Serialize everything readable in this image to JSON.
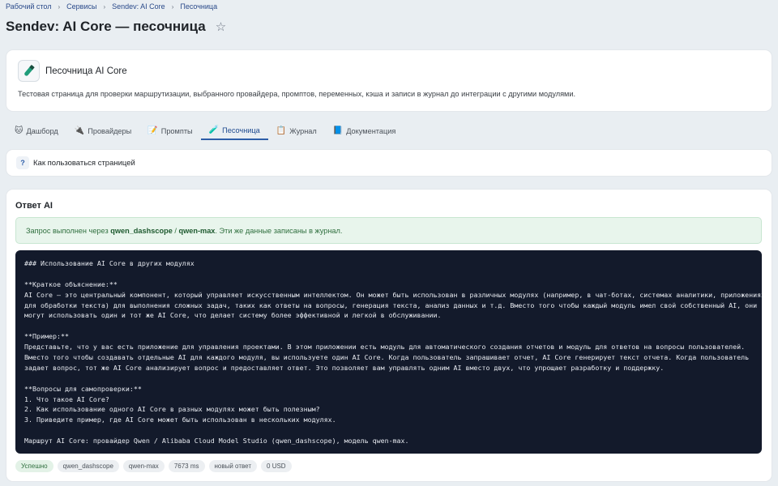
{
  "breadcrumb": [
    "Рабочий стол",
    "Сервисы",
    "Sendev: AI Core",
    "Песочница"
  ],
  "page_title": "Sendev: AI Core — песочница",
  "intro": {
    "title": "Песочница AI Core",
    "description": "Тестовая страница для проверки маршрутизации, выбранного провайдера, промптов, переменных, кэша и записи в журнал до интеграции с другими модулями."
  },
  "tabs": [
    {
      "label": "Дашборд",
      "icon": "🐱"
    },
    {
      "label": "Провайдеры",
      "icon": "🔌"
    },
    {
      "label": "Промпты",
      "icon": "📝"
    },
    {
      "label": "Песочница",
      "icon": "🧪"
    },
    {
      "label": "Журнал",
      "icon": "📋"
    },
    {
      "label": "Документация",
      "icon": "📘"
    }
  ],
  "active_tab": "Песочница",
  "howto": {
    "icon": "?",
    "label": "Как пользоваться страницей"
  },
  "answer": {
    "heading": "Ответ AI",
    "success": {
      "prefix": "Запрос выполнен через ",
      "provider": "qwen_dashscope",
      "slash": " / ",
      "model": "qwen-max",
      "suffix": ". Эти же данные записаны в журнал."
    },
    "response_lines": [
      "### Использование AI Core в других модулях",
      "",
      "**Краткое объяснение:**",
      "AI Core — это центральный компонент, который управляет искусственным интеллектом. Он может быть использован в различных модулях (например, в чат-ботах, системах аналитики, приложениях",
      "для обработки текста) для выполнения сложных задач, таких как ответы на вопросы, генерация текста, анализ данных и т.д. Вместо того чтобы каждый модуль имел свой собственный AI, они",
      "могут использовать один и тот же AI Core, что делает систему более эффективной и легкой в обслуживании.",
      "",
      "**Пример:**",
      "Представьте, что у вас есть приложение для управления проектами. В этом приложении есть модуль для автоматического создания отчетов и модуль для ответов на вопросы пользователей.",
      "Вместо того чтобы создавать отдельные AI для каждого модуля, вы используете один AI Core. Когда пользователь запрашивает отчет, AI Core генерирует текст отчета. Когда пользователь",
      "задает вопрос, тот же AI Core анализирует вопрос и предоставляет ответ. Это позволяет вам управлять одним AI вместо двух, что упрощает разработку и поддержку.",
      "",
      "**Вопросы для самопроверки:**",
      "1. Что такое AI Core?",
      "2. Как использование одного AI Core в разных модулях может быть полезным?",
      "3. Приведите пример, где AI Core может быть использован в нескольких модулях.",
      "",
      "Маршрут AI Core: провайдер Qwen / Alibaba Cloud Model Studio (qwen_dashscope), модель qwen-max."
    ],
    "chips": [
      "Успешно",
      "qwen_dashscope",
      "qwen-max",
      "7673 ms",
      "новый ответ",
      "0 USD"
    ]
  },
  "colors": {
    "accent": "#2d5ea8",
    "success_bg": "#e8f5ec",
    "code_bg": "#131a2b"
  }
}
